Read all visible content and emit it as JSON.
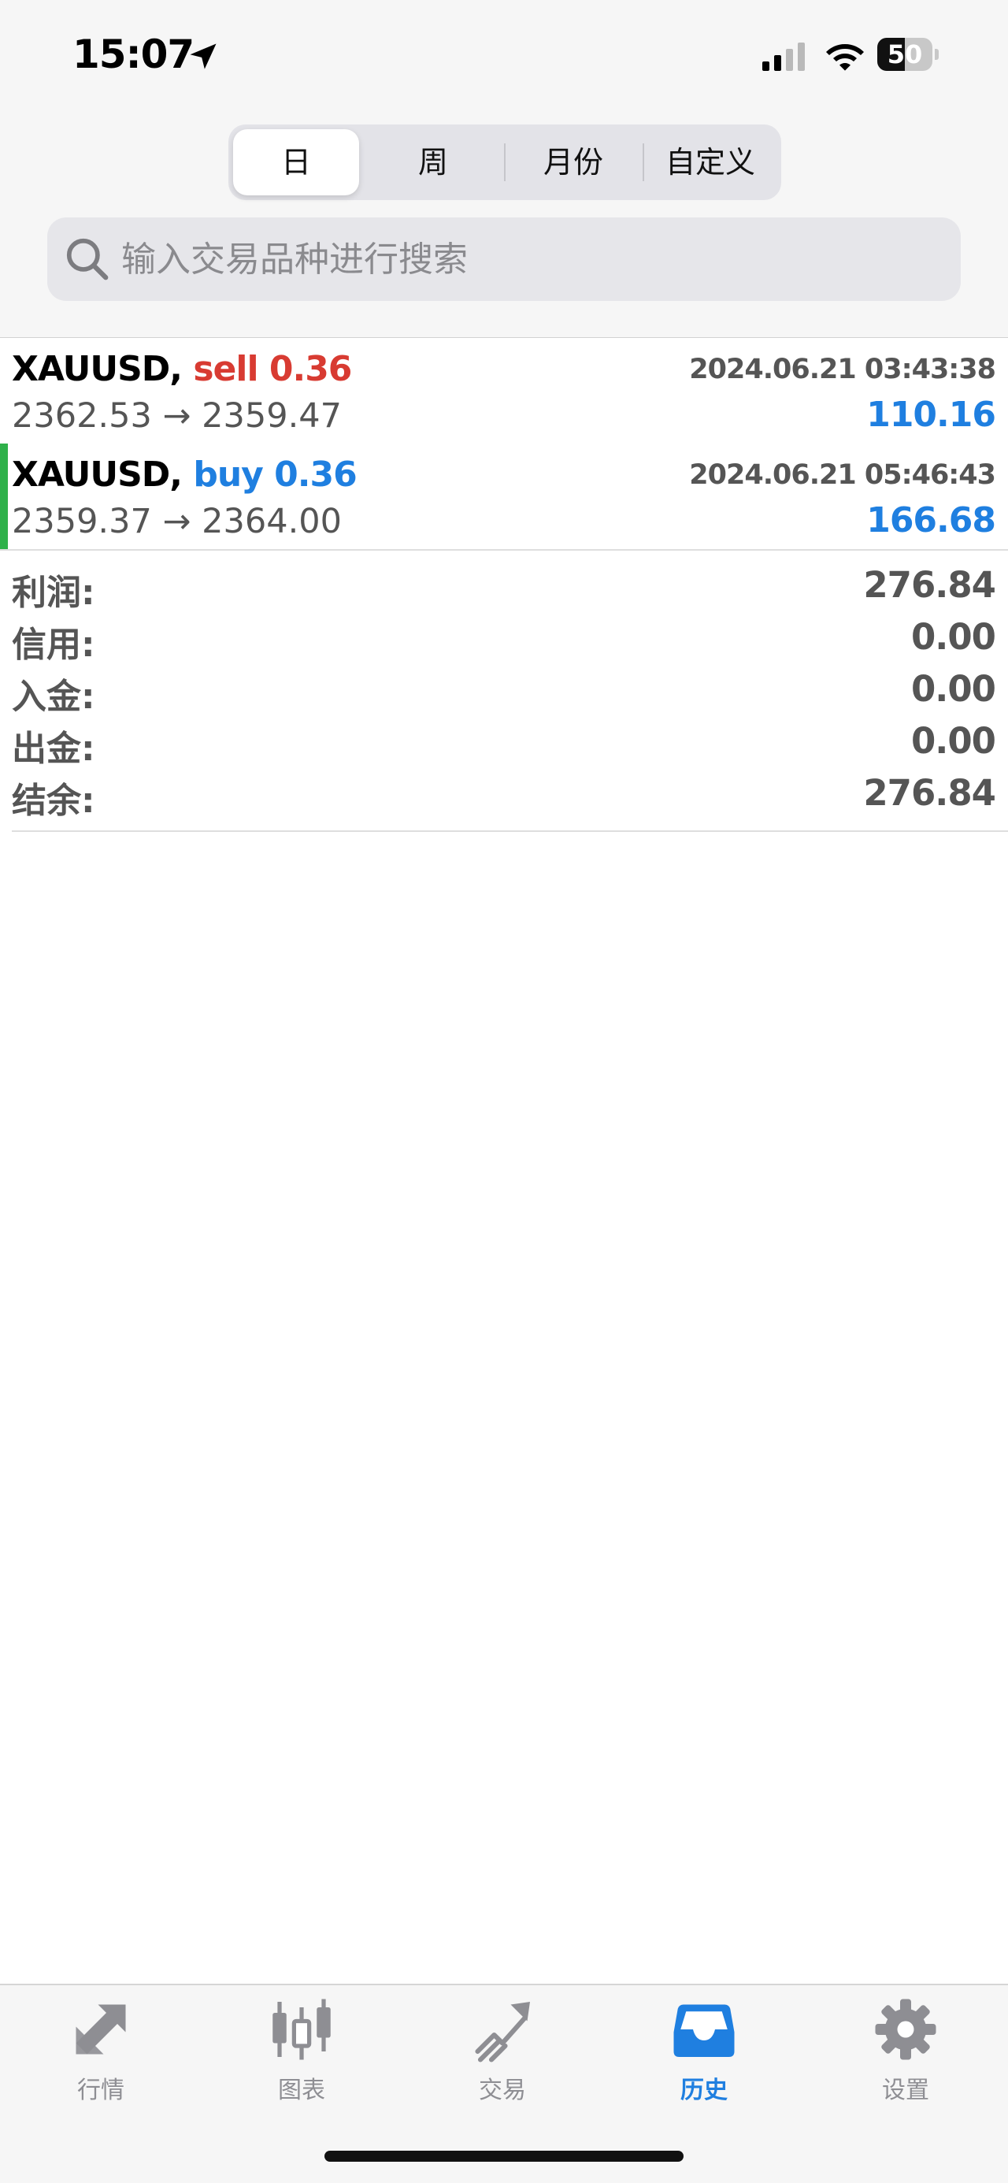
{
  "status_bar": {
    "time": "15:07",
    "battery": "50",
    "battery_level": 0.5
  },
  "period_tabs": {
    "active": 0,
    "items": [
      "日",
      "周",
      "月份",
      "自定义"
    ]
  },
  "search": {
    "placeholder": "输入交易品种进行搜索"
  },
  "deals": [
    {
      "symbol": "XAUUSD,",
      "type": "sell 0.36",
      "time": "2024.06.21 03:43:38",
      "prices": "2362.53 → 2359.47",
      "profit": "110.16",
      "type_color": "#d83b32",
      "profit_color": "#1f7fe0"
    },
    {
      "symbol": "XAUUSD,",
      "type": "buy 0.36",
      "time": "2024.06.21 05:46:43",
      "prices": "2359.37 → 2364.00",
      "profit": "166.68",
      "type_color": "#1f7fe0",
      "profit_color": "#1f7fe0"
    }
  ],
  "summary": [
    {
      "label": "利润:",
      "value": "276.84"
    },
    {
      "label": "信用:",
      "value": "0.00"
    },
    {
      "label": "入金:",
      "value": "0.00"
    },
    {
      "label": "出金:",
      "value": "0.00"
    },
    {
      "label": "结余:",
      "value": "276.84"
    }
  ],
  "tabbar": {
    "active": 3,
    "items": [
      {
        "label": "行情",
        "icon": "quotes-icon"
      },
      {
        "label": "图表",
        "icon": "chart-icon"
      },
      {
        "label": "交易",
        "icon": "trade-icon"
      },
      {
        "label": "历史",
        "icon": "history-icon"
      },
      {
        "label": "设置",
        "icon": "settings-icon"
      }
    ]
  },
  "colors": {
    "accent": "#1f7fe0",
    "sell": "#d83b32",
    "buy": "#1f7fe0",
    "deal_marker": "#2fb14a",
    "inactive": "#8e8e93"
  }
}
